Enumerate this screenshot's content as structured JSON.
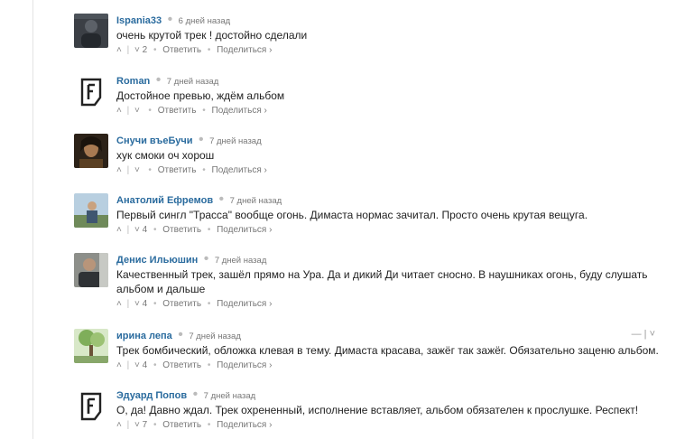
{
  "comments": [
    {
      "author": "Ispania33",
      "time": "6 дней назад",
      "text": "очень крутой трек ! достойно сделали",
      "votes": "2",
      "reply": "Ответить",
      "share": "Поделиться ›",
      "avatar": "photo-dark"
    },
    {
      "author": "Roman",
      "time": "7 дней назад",
      "text": "Достойное превью, ждём альбом",
      "votes": "",
      "reply": "Ответить",
      "share": "Поделиться ›",
      "avatar": "f-logo"
    },
    {
      "author": "Снучи въеБучи",
      "time": "7 дней назад",
      "text": "хук смоки оч хорош",
      "votes": "",
      "reply": "Ответить",
      "share": "Поделиться ›",
      "avatar": "photo-portrait"
    },
    {
      "author": "Анатолий Ефремов",
      "time": "7 дней назад",
      "text": "Первый сингл \"Трасса\" вообще огонь. Димаста нормас зачитал. Просто очень крутая вещуга.",
      "votes": "4",
      "reply": "Ответить",
      "share": "Поделиться ›",
      "avatar": "photo-outdoor"
    },
    {
      "author": "Денис Ильюшин",
      "time": "7 дней назад",
      "text": "Качественный трек, зашёл прямо на Ура. Да и дикий Ди читает сносно. В наушниках огонь, буду слушать альбом и дальше",
      "votes": "4",
      "reply": "Ответить",
      "share": "Поделиться ›",
      "avatar": "photo-man"
    },
    {
      "author": "ирина лепа",
      "time": "7 дней назад",
      "text": "Трек бомбический, обложка клевая в тему. Димаста красава, зажёг так зажёг. Обязательно заценю альбом.",
      "votes": "4",
      "reply": "Ответить",
      "share": "Поделиться ›",
      "avatar": "photo-tree",
      "menu": "— | ˅"
    },
    {
      "author": "Эдуард Попов",
      "time": "7 дней назад",
      "text": "О, да! Давно ждал. Трек охрененный, исполнение вставляет, альбом обязателен к прослушке. Респект!",
      "votes": "7",
      "reply": "Ответить",
      "share": "Поделиться ›",
      "avatar": "f-logo"
    }
  ],
  "vote_controls": {
    "up": "˄",
    "sep": "|",
    "down": "˅",
    "dot": "•"
  },
  "colors": {
    "author": "#2a6b9e",
    "meta": "#777777",
    "text": "#222222"
  }
}
